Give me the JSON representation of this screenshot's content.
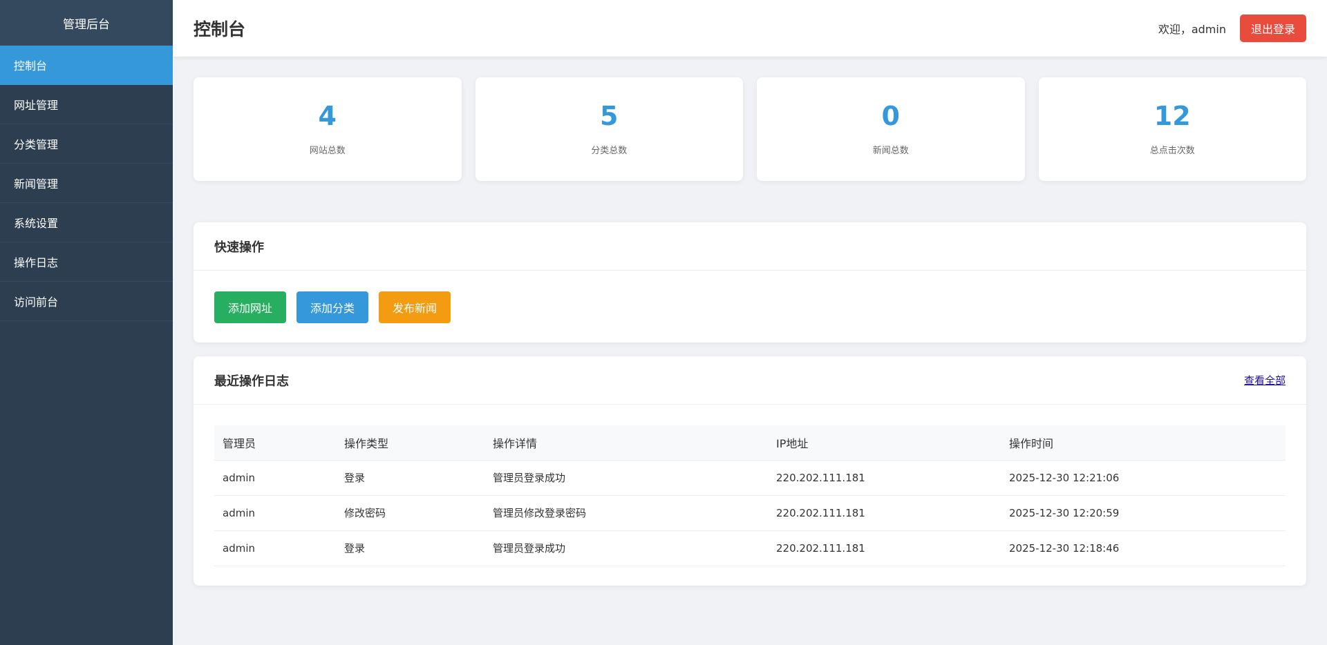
{
  "sidebar": {
    "brand": "管理后台",
    "items": [
      {
        "label": "控制台"
      },
      {
        "label": "网址管理"
      },
      {
        "label": "分类管理"
      },
      {
        "label": "新闻管理"
      },
      {
        "label": "系统设置"
      },
      {
        "label": "操作日志"
      },
      {
        "label": "访问前台"
      }
    ]
  },
  "header": {
    "title": "控制台",
    "welcome": "欢迎，admin",
    "logout_label": "退出登录"
  },
  "stats": [
    {
      "value": "4",
      "label": "网站总数"
    },
    {
      "value": "5",
      "label": "分类总数"
    },
    {
      "value": "0",
      "label": "新闻总数"
    },
    {
      "value": "12",
      "label": "总点击次数"
    }
  ],
  "quick_actions": {
    "title": "快速操作",
    "buttons": [
      {
        "label": "添加网址",
        "color": "#27ae60"
      },
      {
        "label": "添加分类",
        "color": "#3498db"
      },
      {
        "label": "发布新闻",
        "color": "#f39c12"
      }
    ]
  },
  "recent_logs": {
    "title": "最近操作日志",
    "view_all": "查看全部",
    "columns": [
      "管理员",
      "操作类型",
      "操作详情",
      "IP地址",
      "操作时间"
    ],
    "rows": [
      [
        "admin",
        "登录",
        "管理员登录成功",
        "220.202.111.181",
        "2025-12-30 12:21:06"
      ],
      [
        "admin",
        "修改密码",
        "管理员修改登录密码",
        "220.202.111.181",
        "2025-12-30 12:20:59"
      ],
      [
        "admin",
        "登录",
        "管理员登录成功",
        "220.202.111.181",
        "2025-12-30 12:18:46"
      ]
    ]
  },
  "colors": {
    "sidebar_bg": "#2c3e50",
    "accent": "#3498db",
    "danger": "#e74c3c"
  }
}
